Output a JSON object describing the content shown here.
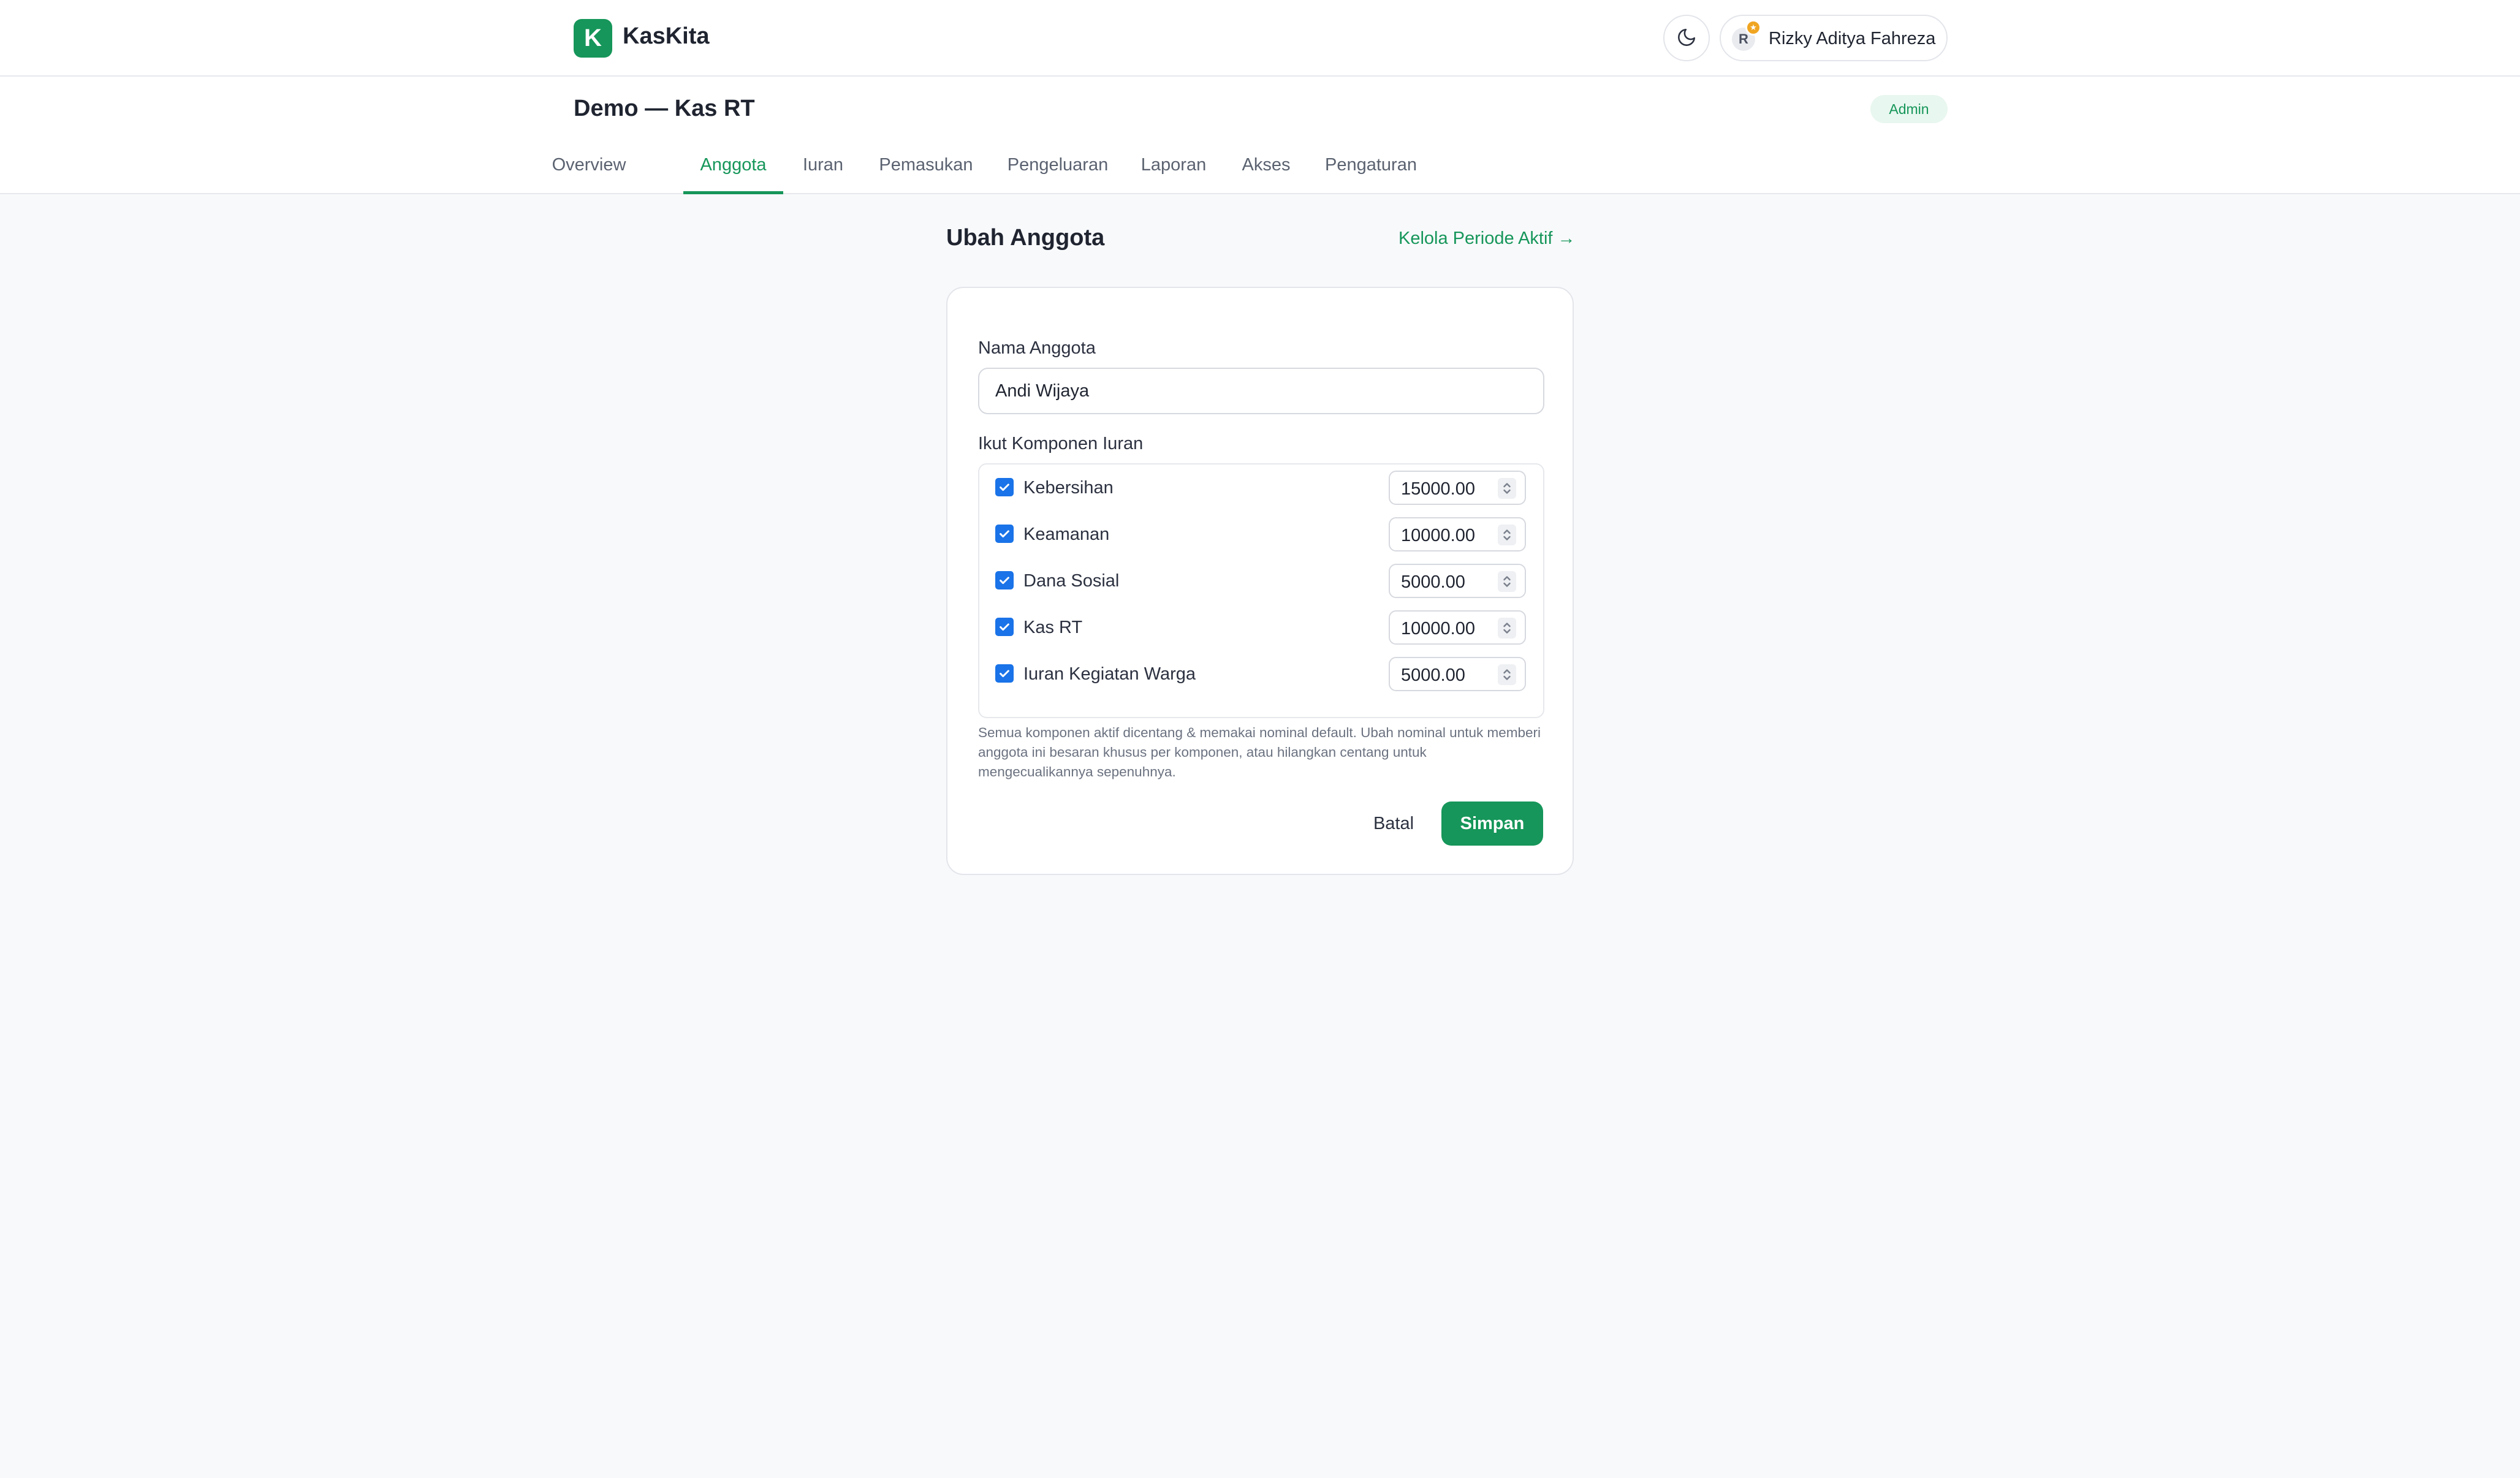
{
  "app": {
    "logo_letter": "K",
    "name": "KasKita"
  },
  "header": {
    "theme_toggle_icon": "moon-icon",
    "user": {
      "initial": "R",
      "name": "Rizky Aditya Fahreza",
      "badge_icon": "star-icon"
    }
  },
  "subheader": {
    "title": "Demo — Kas RT",
    "role": "Admin",
    "tabs": [
      {
        "label": "Overview",
        "active": false
      },
      {
        "label": "Anggota",
        "active": true
      },
      {
        "label": "Iuran",
        "active": false
      },
      {
        "label": "Pemasukan",
        "active": false
      },
      {
        "label": "Pengeluaran",
        "active": false
      },
      {
        "label": "Laporan",
        "active": false
      },
      {
        "label": "Akses",
        "active": false
      },
      {
        "label": "Pengaturan",
        "active": false
      }
    ]
  },
  "form": {
    "title": "Ubah Anggota",
    "manage_link": "Kelola Periode Aktif →",
    "name_label": "Nama Anggota",
    "name_value": "Andi Wijaya",
    "components_label": "Ikut Komponen Iuran",
    "components": [
      {
        "label": "Kebersihan",
        "checked": true,
        "amount": "15000.00"
      },
      {
        "label": "Keamanan",
        "checked": true,
        "amount": "10000.00"
      },
      {
        "label": "Dana Sosial",
        "checked": true,
        "amount": "5000.00"
      },
      {
        "label": "Kas RT",
        "checked": true,
        "amount": "10000.00"
      },
      {
        "label": "Iuran Kegiatan Warga",
        "checked": true,
        "amount": "5000.00"
      }
    ],
    "help_text": "Semua komponen aktif dicentang & memakai nominal default. Ubah nominal untuk memberi anggota ini besaran khusus per komponen, atau hilangkan centang untuk mengecualikannya sepenuhnya.",
    "cancel_label": "Batal",
    "save_label": "Simpan"
  },
  "colors": {
    "accent": "#16965a",
    "checkbox": "#1a73e8",
    "background": "#f8f9fb",
    "badge": "#f0a521"
  }
}
